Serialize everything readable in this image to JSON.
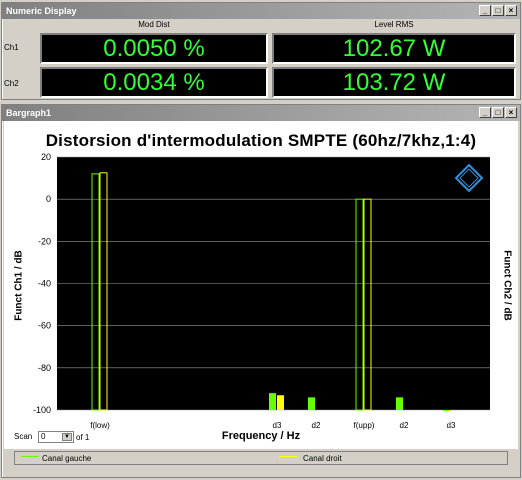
{
  "numeric_display": {
    "title": "Numeric Display",
    "col_headers": [
      "Mod Dist",
      "Level RMS"
    ],
    "rows": [
      {
        "label": "Ch1",
        "mod_dist": "0.0050 %",
        "level_rms": "102.67 W"
      },
      {
        "label": "Ch2",
        "mod_dist": "0.0034 %",
        "level_rms": "103.72 W"
      }
    ]
  },
  "window_controls": {
    "minimize": "_",
    "maximize": "□",
    "close": "×"
  },
  "bargraph": {
    "title": "Bargraph1",
    "scan_label": "Scan",
    "scan_value": "0",
    "scan_of": "of 1",
    "legend": [
      {
        "label": "Canal gauche",
        "color": "#66ff00"
      },
      {
        "label": "Canal droit",
        "color": "#ffff00"
      }
    ]
  },
  "chart_data": {
    "type": "bar",
    "title": "Distorsion d'intermodulation SMPTE (60hz/7khz,1:4)",
    "xlabel": "Frequency / Hz",
    "ylabel_left": "Funct Ch1 / dB",
    "ylabel_right": "Funct Ch2 / dB",
    "ylim": [
      -100,
      20
    ],
    "yticks": [
      20,
      0,
      -20,
      -40,
      -60,
      -80,
      -100
    ],
    "grid": true,
    "categories": [
      "f(low)",
      "d3",
      "d2",
      "f(upp)",
      "d2",
      "d3"
    ],
    "series": [
      {
        "name": "Canal gauche",
        "color": "#66ff00",
        "values": [
          12,
          -92,
          -94,
          0,
          -94,
          -100
        ]
      },
      {
        "name": "Canal droit",
        "color": "#ffff00",
        "values": [
          12.5,
          -93,
          null,
          0,
          null,
          null
        ]
      }
    ]
  }
}
